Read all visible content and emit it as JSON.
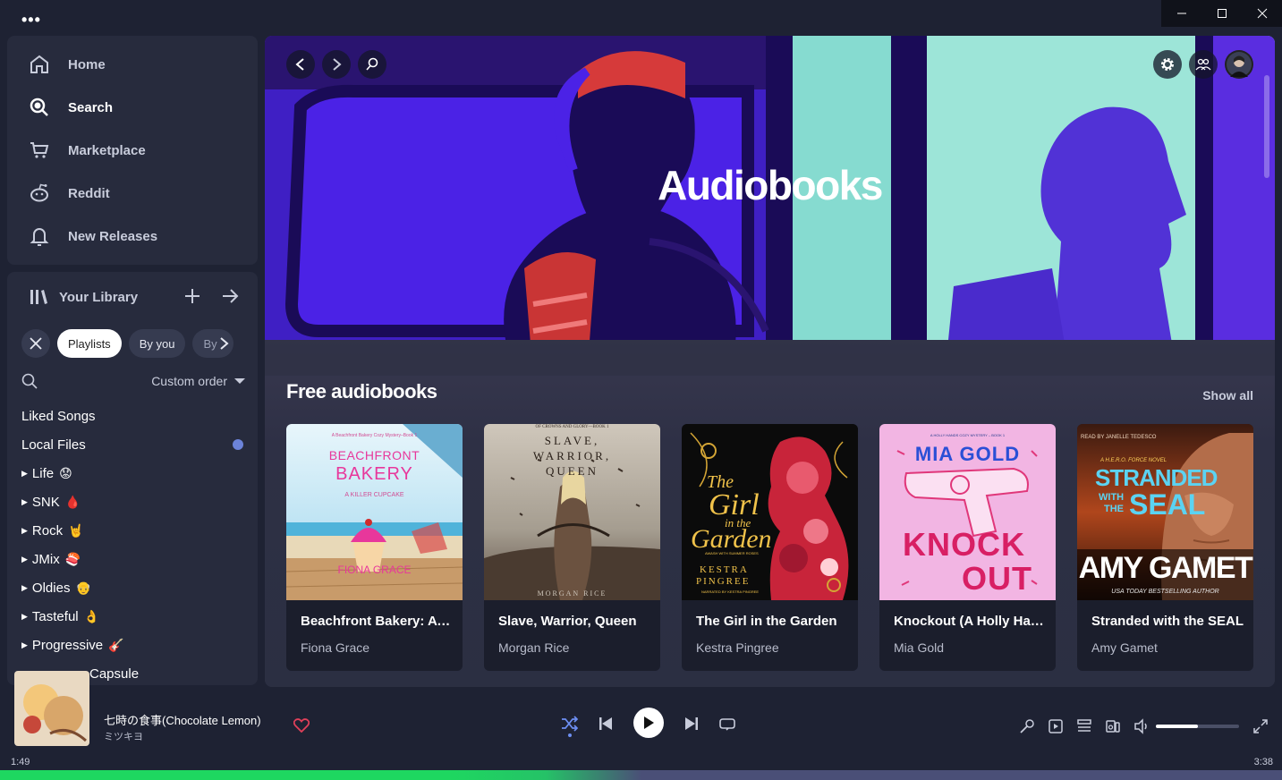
{
  "nav": {
    "items": [
      {
        "label": "Home",
        "icon": "home-icon"
      },
      {
        "label": "Search",
        "icon": "search-icon"
      },
      {
        "label": "Marketplace",
        "icon": "cart-icon"
      },
      {
        "label": "Reddit",
        "icon": "reddit-icon"
      },
      {
        "label": "New Releases",
        "icon": "bell-icon"
      }
    ]
  },
  "library": {
    "title": "Your Library",
    "chips": [
      "Playlists",
      "By you",
      "By"
    ],
    "sort_label": "Custom order",
    "items": [
      {
        "label": "Liked Songs",
        "folder": false,
        "emoji": ""
      },
      {
        "label": "Local Files",
        "folder": false,
        "emoji": ""
      },
      {
        "label": "Life",
        "folder": true,
        "emoji": "😟"
      },
      {
        "label": "SNK",
        "folder": true,
        "emoji": "🩸"
      },
      {
        "label": "Rock",
        "folder": true,
        "emoji": "🤘"
      },
      {
        "label": "JMix",
        "folder": true,
        "emoji": "🍣"
      },
      {
        "label": "Oldies",
        "folder": true,
        "emoji": "👴"
      },
      {
        "label": "Tasteful",
        "folder": true,
        "emoji": "👌"
      },
      {
        "label": "Progressive",
        "folder": true,
        "emoji": "🎸"
      },
      {
        "label": "Capsule",
        "folder": false,
        "emoji": ""
      }
    ]
  },
  "hero": {
    "title": "Audiobooks"
  },
  "section": {
    "title": "Free audiobooks",
    "show_all": "Show all",
    "cards": [
      {
        "title": "Beachfront Bakery: A Killer Cupcake",
        "author": "Fiona Grace",
        "cover": {
          "kicker": "A Beachfront Bakery Cozy Mystery–Book 1",
          "line1": "BEACHFRONT",
          "line2": "BAKERY",
          "line3": "A KILLER CUPCAKE",
          "author": "FIONA GRACE"
        }
      },
      {
        "title": "Slave, Warrior, Queen",
        "author": "Morgan Rice",
        "cover": {
          "kicker": "OF CROWNS AND GLORY—BOOK 1",
          "line1": "SLAVE,",
          "line2": "WARRIOR,",
          "line3": "QUEEN",
          "author": "MORGAN RICE"
        }
      },
      {
        "title": "The Girl in the Garden",
        "author": "Kestra Pingree",
        "cover": {
          "line1": "The",
          "line2": "Girl",
          "line3": "in the",
          "line4": "Garden",
          "author1": "KESTRA",
          "author2": "PINGREE",
          "sub": "AWASH WITH SUMMER ROSES",
          "narr": "NARRATED BY KESTRA PINGREE"
        }
      },
      {
        "title": "Knockout (A Holly Hands Cozy Mystery)",
        "author": "Mia Gold",
        "cover": {
          "kicker": "A HOLLY HANDS COZY MYSTERY – BOOK 1",
          "author": "MIA GOLD",
          "line1": "KNOCK",
          "line2": "OUT"
        }
      },
      {
        "title": "Stranded with the SEAL",
        "author": "Amy Gamet",
        "cover": {
          "kicker": "READ BY JANELLE TEDESCO",
          "series": "A H.E.R.O. FORCE NOVEL",
          "line1": "STRANDED",
          "line2": "WITH",
          "line3": "THE",
          "line4": "SEAL",
          "author": "AMY GAMET",
          "tag": "USA TODAY BESTSELLING AUTHOR"
        }
      }
    ]
  },
  "player": {
    "title": "七時の食事(Chocolate Lemon)",
    "artist": "ミツキヨ",
    "elapsed": "1:49",
    "duration": "3:38",
    "progress": 0.5,
    "volume": 0.5
  },
  "colors": {
    "accent": "#1ed760",
    "bg": "#1e2233",
    "panel": "#272b3d"
  }
}
